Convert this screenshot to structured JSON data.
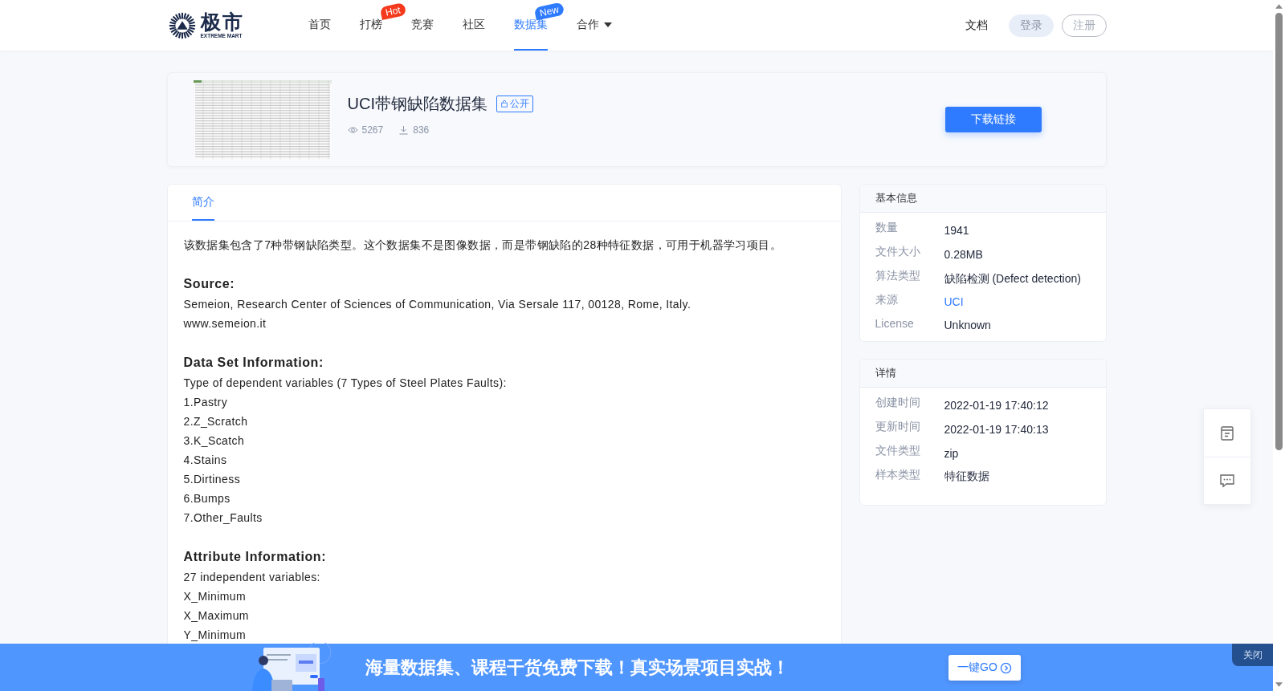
{
  "header": {
    "logo": {
      "name": "极市",
      "tagline": "EXTREME MART"
    },
    "nav": [
      {
        "label": "首页",
        "selected": false,
        "kind": "link"
      },
      {
        "label": "打榜",
        "selected": false,
        "kind": "link",
        "badge": {
          "text": "Hot",
          "color": "#f4391c"
        }
      },
      {
        "label": "竞赛",
        "selected": false,
        "kind": "link"
      },
      {
        "label": "社区",
        "selected": false,
        "kind": "link"
      },
      {
        "label": "数据集",
        "selected": true,
        "kind": "link",
        "badge": {
          "text": "New",
          "color": "#2f7bff"
        }
      },
      {
        "label": "合作",
        "selected": false,
        "kind": "menu"
      }
    ],
    "docs": "文档",
    "login": "登录",
    "register": "注册"
  },
  "dataset": {
    "title": "UCI带钢缺陷数据集",
    "visibility": "公开",
    "views": "5267",
    "downloads": "836",
    "download_button": "下载链接"
  },
  "tabs": [
    {
      "label": "简介",
      "selected": true
    }
  ],
  "description": [
    {
      "kind": "paragraph",
      "text": "该数据集包含了7种带钢缺陷类型。这个数据集不是图像数据，而是带钢缺陷的28种特征数据，可用于机器学习项目。"
    },
    {
      "kind": "heading",
      "text": "Source:"
    },
    {
      "kind": "line",
      "text": "Semeion, Research Center of Sciences of Communication, Via Sersale 117, 00128, Rome, Italy."
    },
    {
      "kind": "line",
      "text": "www.semeion.it"
    },
    {
      "kind": "heading",
      "text": "Data Set Information:"
    },
    {
      "kind": "line",
      "text": "Type of dependent variables (7 Types of Steel Plates Faults):"
    },
    {
      "kind": "line",
      "text": "1.Pastry"
    },
    {
      "kind": "line",
      "text": "2.Z_Scratch"
    },
    {
      "kind": "line",
      "text": "3.K_Scatch"
    },
    {
      "kind": "line",
      "text": "4.Stains"
    },
    {
      "kind": "line",
      "text": "5.Dirtiness"
    },
    {
      "kind": "line",
      "text": "6.Bumps"
    },
    {
      "kind": "line",
      "text": "7.Other_Faults"
    },
    {
      "kind": "heading",
      "text": "Attribute Information:"
    },
    {
      "kind": "line",
      "text": "27 independent variables:"
    },
    {
      "kind": "line",
      "text": "X_Minimum"
    },
    {
      "kind": "line",
      "text": "X_Maximum"
    },
    {
      "kind": "line",
      "text": "Y_Minimum"
    }
  ],
  "panels": [
    {
      "title": "基本信息",
      "rows": [
        {
          "label": "数量",
          "value": "1941",
          "kind": "text"
        },
        {
          "label": "文件大小",
          "value": "0.28MB",
          "kind": "text"
        },
        {
          "label": "算法类型",
          "value": "缺陷检测 (Defect detection)",
          "kind": "text"
        },
        {
          "label": "来源",
          "value": "UCI",
          "kind": "link"
        },
        {
          "label": "License",
          "value": "Unknown",
          "kind": "text"
        }
      ]
    },
    {
      "title": "详情",
      "rows": [
        {
          "label": "创建时间",
          "value": "2022-01-19 17:40:12",
          "kind": "text"
        },
        {
          "label": "更新时间",
          "value": "2022-01-19 17:40:13",
          "kind": "text"
        },
        {
          "label": "文件类型",
          "value": "zip",
          "kind": "text"
        },
        {
          "label": "样本类型",
          "value": "特征数据",
          "kind": "text"
        }
      ]
    }
  ],
  "banner": {
    "headline": "海量数据集、课程干货免费下载！真实场景项目实战！",
    "button": "一键GO",
    "close": "关闭"
  }
}
